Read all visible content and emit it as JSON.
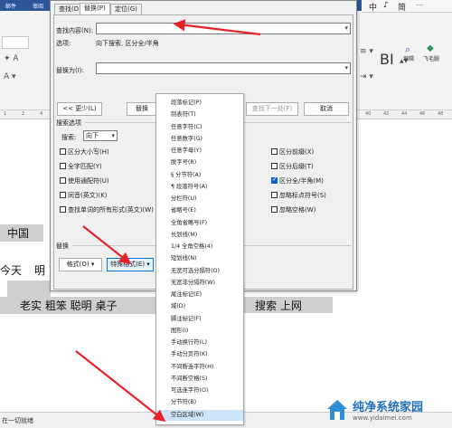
{
  "ribbon": {
    "tabs": [
      "邮件",
      "审阅"
    ],
    "right_groups": [
      "编辑",
      "飞毛腿"
    ],
    "style_preview": "BI"
  },
  "lang_bar": {
    "items": [
      "中",
      "♪",
      "简"
    ]
  },
  "dialog": {
    "tabs": [
      "查找(D)",
      "替换(P)",
      "定位(G)"
    ],
    "find_label": "查找内容(N):",
    "find_value": "",
    "options_label": "选项:",
    "options_value": "向下搜索, 区分全/半角",
    "replace_label": "替换为(I):",
    "replace_value": "",
    "less_button": "<< 更少(L)",
    "replace_button": "替换",
    "find_next_button": "查找下一处(F)",
    "cancel_button": "取消",
    "search_options_title": "搜索选项",
    "search_label": "搜索:",
    "search_value": "向下",
    "left_checks": [
      {
        "label": "区分大小写(H)",
        "checked": false
      },
      {
        "label": "全字匹配(Y)",
        "checked": false
      },
      {
        "label": "使用通配符(U)",
        "checked": false
      },
      {
        "label": "同音(英文)(K)",
        "checked": false
      },
      {
        "label": "查找单词的所有形式(英文)(W)",
        "checked": false
      }
    ],
    "right_checks": [
      {
        "label": "区分前缀(X)",
        "checked": false
      },
      {
        "label": "区分后缀(T)",
        "checked": false
      },
      {
        "label": "区分全/半角(M)",
        "checked": true
      },
      {
        "label": "忽略标点符号(S)",
        "checked": false
      },
      {
        "label": "忽略空格(W)",
        "checked": false
      }
    ],
    "replace_section_title": "替换",
    "format_button": "格式(O) ▾",
    "special_button": "特殊格式(E) ▾"
  },
  "special_menu": {
    "items": [
      "段落标记(P)",
      "制表符(T)",
      "任意字符(C)",
      "任意数字(G)",
      "任意字母(Y)",
      "脱字号(R)",
      "§ 分节符(A)",
      "¶ 段落符号(A)",
      "分栏符(U)",
      "省略号(E)",
      "全角省略号(F)",
      "长划线(M)",
      "1/4 全角空格(4)",
      "短划线(N)",
      "无宽可选分隔符(O)",
      "无宽非分隔符(W)",
      "尾注标记(E)",
      "域(D)",
      "脚注标记(F)",
      "图形(I)",
      "手动换行符(L)",
      "手动分页符(K)",
      "不间断连字符(H)",
      "不间断空格(S)",
      "可选连字符(O)",
      "分节符(B)",
      "空白区域(W)"
    ],
    "hover_index": 26
  },
  "document": {
    "line1": "中国",
    "line2_left": "今天",
    "line2_right": "明",
    "line3": "老实   粗笨   聪明  桌子",
    "line3_right": "搜索  上网"
  },
  "status": {
    "left": "在一切就绪"
  },
  "watermark": {
    "title": "纯净系统家园",
    "url": "www.yidaimei.com"
  },
  "colors": {
    "arrow": "#e8202a",
    "ribbon_blue": "#2b579a",
    "hover": "#cce4f7"
  }
}
